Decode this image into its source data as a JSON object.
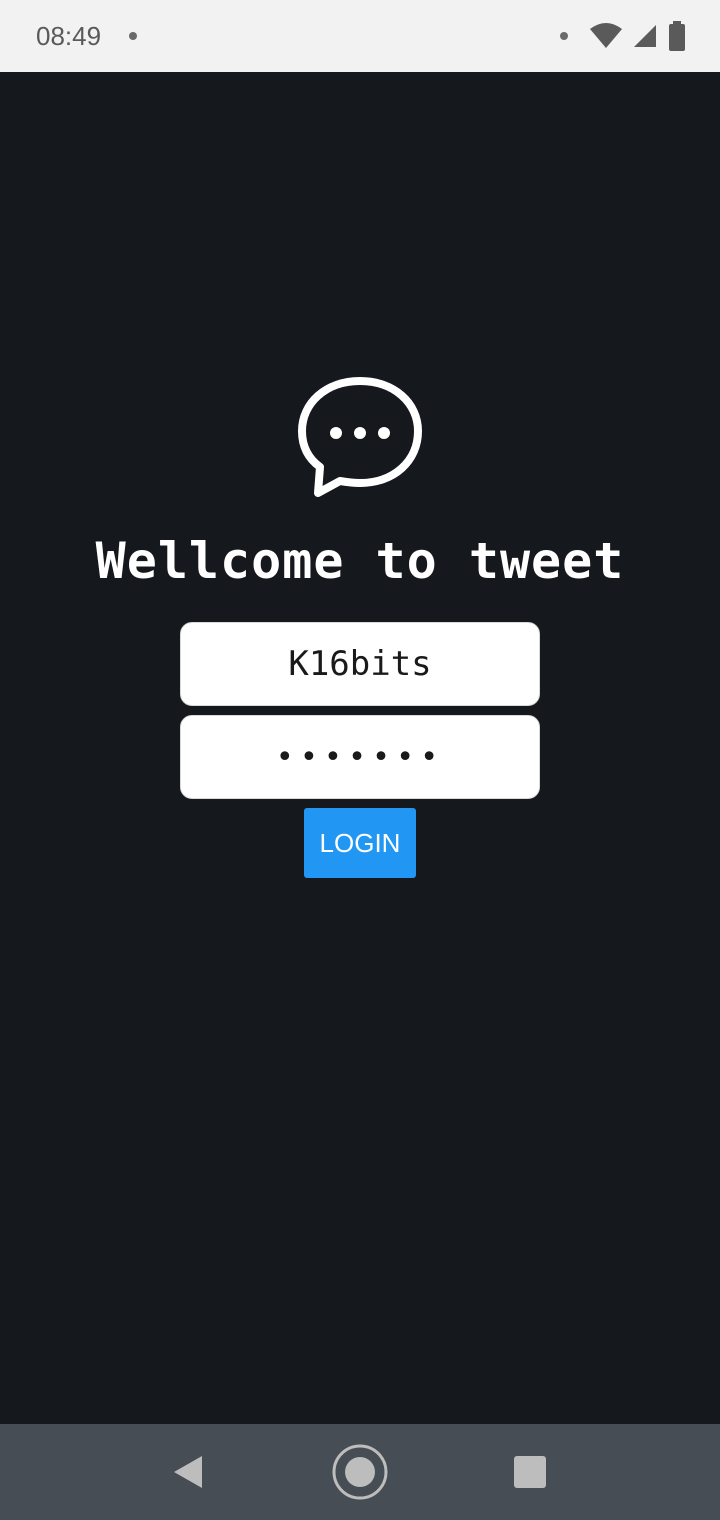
{
  "status_bar": {
    "time": "08:49"
  },
  "app": {
    "title": "Wellcome to tweet",
    "username_value": "K16bits",
    "password_value": "•••••••",
    "login_label": "LOGIN"
  },
  "colors": {
    "background": "#15181c",
    "login_button": "#2196f3",
    "nav_bar": "#474d54",
    "status_bar": "#f2f2f2"
  }
}
